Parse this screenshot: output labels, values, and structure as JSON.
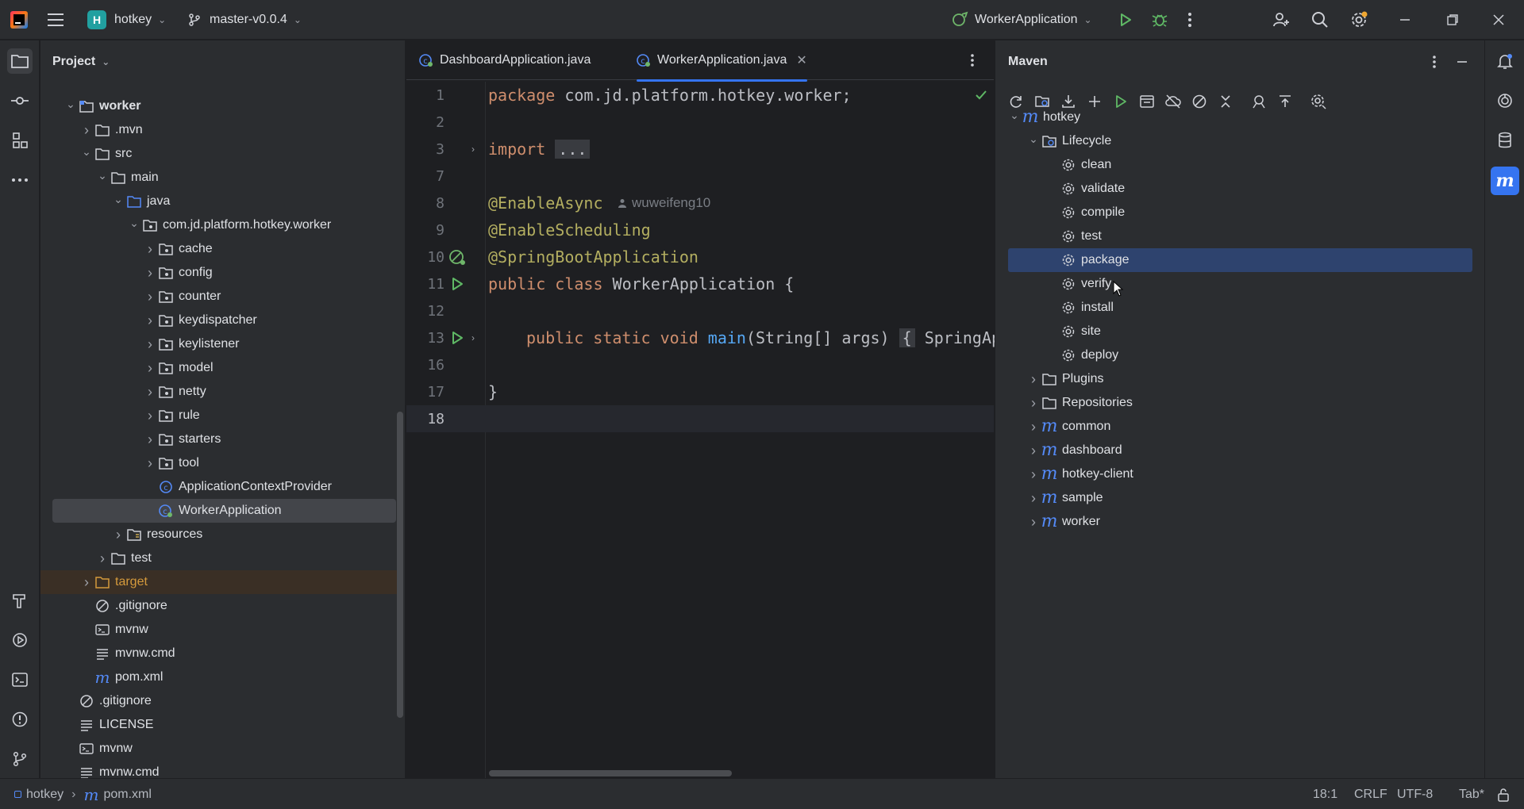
{
  "titlebar": {
    "project_initial": "H",
    "project_name": "hotkey",
    "branch": "master-v0.0.4",
    "run_config": "WorkerApplication"
  },
  "project_panel": {
    "title": "Project",
    "tree": [
      {
        "label": "worker",
        "type": "module",
        "bold": true,
        "expanded": true
      },
      {
        "label": ".mvn",
        "type": "folder",
        "expanded": false
      },
      {
        "label": "src",
        "type": "folder",
        "expanded": true
      },
      {
        "label": "main",
        "type": "folder",
        "expanded": true
      },
      {
        "label": "java",
        "type": "source-folder",
        "expanded": true
      },
      {
        "label": "com.jd.platform.hotkey.worker",
        "type": "package",
        "expanded": true
      },
      {
        "label": "cache",
        "type": "package",
        "expanded": false
      },
      {
        "label": "config",
        "type": "package",
        "expanded": false
      },
      {
        "label": "counter",
        "type": "package",
        "expanded": false
      },
      {
        "label": "keydispatcher",
        "type": "package",
        "expanded": false
      },
      {
        "label": "keylistener",
        "type": "package",
        "expanded": false
      },
      {
        "label": "model",
        "type": "package",
        "expanded": false
      },
      {
        "label": "netty",
        "type": "package",
        "expanded": false
      },
      {
        "label": "rule",
        "type": "package",
        "expanded": false
      },
      {
        "label": "starters",
        "type": "package",
        "expanded": false
      },
      {
        "label": "tool",
        "type": "package",
        "expanded": false
      },
      {
        "label": "ApplicationContextProvider",
        "type": "class"
      },
      {
        "label": "WorkerApplication",
        "type": "spring-class",
        "selected": true
      },
      {
        "label": "resources",
        "type": "resources-folder",
        "expanded": false
      },
      {
        "label": "test",
        "type": "folder",
        "expanded": false
      },
      {
        "label": "target",
        "type": "excluded-folder",
        "expanded": false
      },
      {
        "label": ".gitignore",
        "type": "ignore-file"
      },
      {
        "label": "mvnw",
        "type": "shell-file"
      },
      {
        "label": "mvnw.cmd",
        "type": "text-file"
      },
      {
        "label": "pom.xml",
        "type": "maven-file"
      },
      {
        "label": ".gitignore",
        "type": "ignore-file"
      },
      {
        "label": "LICENSE",
        "type": "text-file"
      },
      {
        "label": "mvnw",
        "type": "shell-file"
      },
      {
        "label": "mvnw.cmd",
        "type": "text-file"
      }
    ]
  },
  "editor": {
    "tabs": [
      {
        "label": "DashboardApplication.java",
        "active": false
      },
      {
        "label": "WorkerApplication.java",
        "active": true
      }
    ],
    "lines": [
      {
        "num": "1"
      },
      {
        "num": "2"
      },
      {
        "num": "3"
      },
      {
        "num": "7"
      },
      {
        "num": "8"
      },
      {
        "num": "9"
      },
      {
        "num": "10"
      },
      {
        "num": "11"
      },
      {
        "num": "12"
      },
      {
        "num": "13"
      },
      {
        "num": "16"
      },
      {
        "num": "17"
      },
      {
        "num": "18"
      }
    ],
    "code": {
      "l1_kw": "package",
      "l1_rest": " com.jd.platform.hotkey.worker;",
      "l3_kw": "import",
      "l3_fold": "...",
      "l8_ann": "@EnableAsync",
      "l8_author": "wuweifeng10",
      "l9_ann": "@EnableScheduling",
      "l10_ann": "@SpringBootApplication",
      "l11_kw": "public class",
      "l11_rest": " WorkerApplication {",
      "l13_kw": "public static void",
      "l13_fn": "main",
      "l13_rest": "(String[] args)",
      "l13_fold": "{",
      "l13_tail": " SpringAp",
      "l17_brace": "}"
    }
  },
  "maven": {
    "title": "Maven",
    "root": "hotkey",
    "lifecycle_label": "Lifecycle",
    "lifecycle": [
      "clean",
      "validate",
      "compile",
      "test",
      "package",
      "verify",
      "install",
      "site",
      "deploy"
    ],
    "selected_goal": "package",
    "groups": [
      {
        "label": "Plugins",
        "type": "folder"
      },
      {
        "label": "Repositories",
        "type": "folder"
      },
      {
        "label": "common",
        "type": "module"
      },
      {
        "label": "dashboard",
        "type": "module"
      },
      {
        "label": "hotkey-client",
        "type": "module"
      },
      {
        "label": "sample",
        "type": "module"
      },
      {
        "label": "worker",
        "type": "module"
      }
    ]
  },
  "statusbar": {
    "breadcrumb_project": "hotkey",
    "breadcrumb_file": "pom.xml",
    "position": "18:1",
    "line_sep": "CRLF",
    "encoding": "UTF-8",
    "indent": "Tab*"
  },
  "colors": {
    "accent": "#3574f0",
    "selection": "#2e436e",
    "keyword": "#cf8e6d",
    "annotation": "#b3ae60",
    "function": "#56a8f5",
    "run_green": "#5fb865"
  }
}
